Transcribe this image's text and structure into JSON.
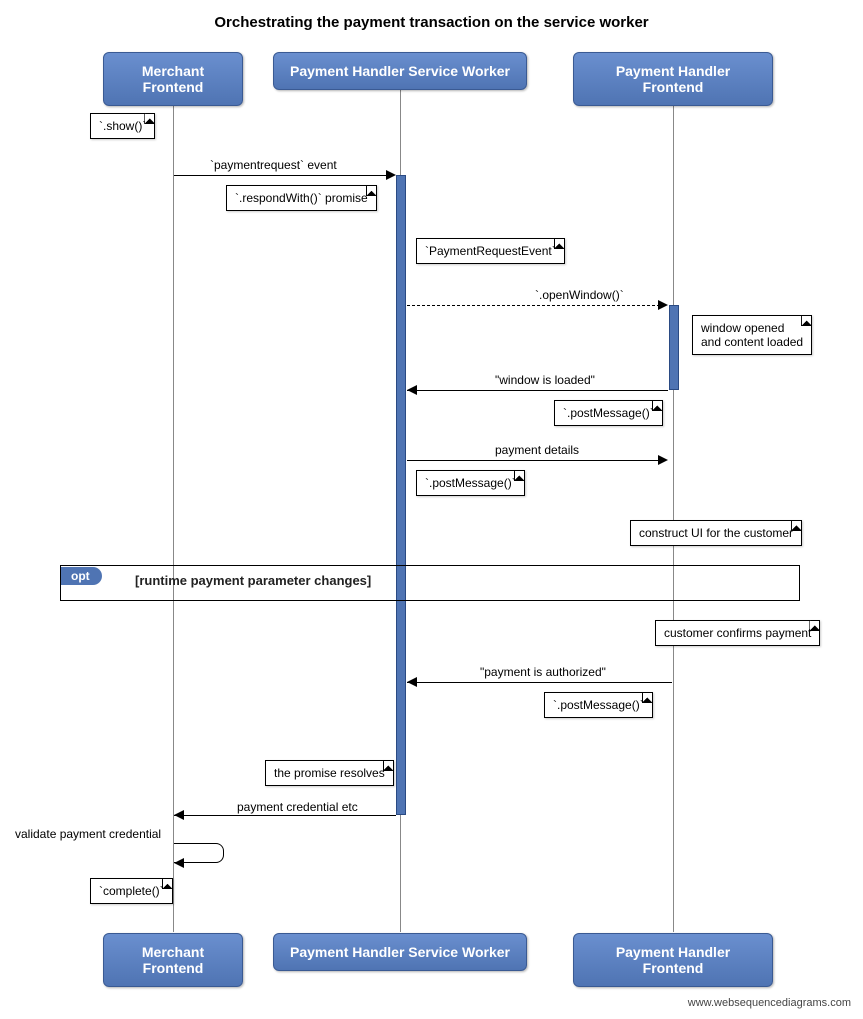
{
  "title": "Orchestrating the payment transaction on the service worker",
  "participants": {
    "a": "Merchant Frontend",
    "b": "Payment Handler Service Worker",
    "c": "Payment Handler Frontend"
  },
  "notes": {
    "show": "`.show()`",
    "respondWith": "`.respondWith()` promise",
    "paymentRequestEvent": "`PaymentRequestEvent`",
    "windowOpened": "window opened\nand content loaded",
    "postMessage1": "`.postMessage()`",
    "postMessage2": "`.postMessage()`",
    "constructUI": "construct UI for the customer",
    "customerConfirms": "customer confirms payment",
    "postMessage3": "`.postMessage()`",
    "promiseResolves": "the promise resolves",
    "complete": "`complete()`"
  },
  "messages": {
    "paymentrequestEvent": "`paymentrequest` event",
    "openWindow": "`.openWindow()`",
    "windowLoaded": "\"window is loaded\"",
    "paymentDetails": "payment details",
    "paymentAuthorized": "\"payment is authorized\"",
    "paymentCredential": "payment credential etc",
    "validate": "validate payment credential"
  },
  "opt": {
    "tag": "opt",
    "guard": "[runtime payment parameter changes]"
  },
  "watermark": "www.websequencediagrams.com"
}
